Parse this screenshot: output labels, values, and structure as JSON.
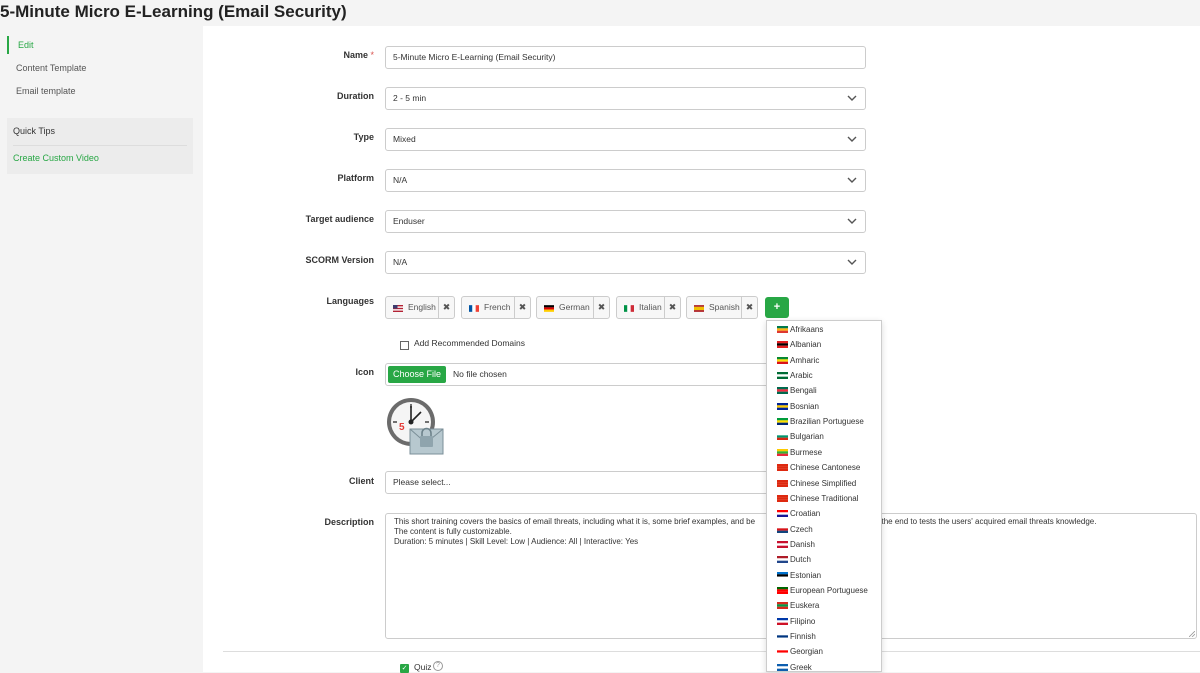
{
  "page": {
    "title": "5-Minute Micro E-Learning (Email Security)"
  },
  "sidebar": {
    "items": [
      {
        "label": "Edit",
        "active": true
      },
      {
        "label": "Content Template",
        "active": false
      },
      {
        "label": "Email template",
        "active": false
      }
    ],
    "tips": {
      "title": "Quick Tips",
      "link": "Create Custom Video"
    }
  },
  "form": {
    "name": {
      "label": "Name",
      "required_mark": "*",
      "value": "5-Minute Micro E-Learning (Email Security)"
    },
    "duration": {
      "label": "Duration",
      "value": "2 - 5 min"
    },
    "type": {
      "label": "Type",
      "value": "Mixed"
    },
    "platform": {
      "label": "Platform",
      "value": "N/A"
    },
    "target_audience": {
      "label": "Target audience",
      "value": "Enduser"
    },
    "scorm": {
      "label": "SCORM Version",
      "value": "N/A"
    },
    "languages": {
      "label": "Languages",
      "selected": [
        {
          "label": "English",
          "flag": [
            "#b22234",
            "#ffffff",
            "#3c3b6e"
          ]
        },
        {
          "label": "French",
          "flag": [
            "#0055a4",
            "#ffffff",
            "#ef4135"
          ]
        },
        {
          "label": "German",
          "flag": [
            "#000000",
            "#dd0000",
            "#ffce00"
          ]
        },
        {
          "label": "Italian",
          "flag": [
            "#009246",
            "#ffffff",
            "#ce2b37"
          ]
        },
        {
          "label": "Spanish",
          "flag": [
            "#aa151b",
            "#f1bf00",
            "#aa151b"
          ]
        }
      ],
      "remove_glyph": "✖",
      "add_label": "+"
    },
    "recommended_domains": {
      "label": "Add Recommended Domains",
      "checked": false
    },
    "icon": {
      "label": "Icon",
      "button": "Choose File",
      "status": "No file chosen"
    },
    "client": {
      "label": "Client",
      "placeholder": "Please select..."
    },
    "description": {
      "label": "Description",
      "lines": [
        "This short training covers the basics of email threats, including what it is, some brief examples, and be",
        "llenge at the end to tests the users' acquired email threats knowledge.",
        "The content is fully customizable.",
        "Duration: 5 minutes | Skill Level: Low | Audience: All | Interactive: Yes"
      ]
    },
    "quiz": {
      "label": "Quiz",
      "checked": true,
      "help": "?"
    }
  },
  "language_dropdown": {
    "options": [
      {
        "label": "Afrikaans",
        "flag": [
          "#007a4d",
          "#ffb612",
          "#de3831"
        ]
      },
      {
        "label": "Albanian",
        "flag": [
          "#e41e20",
          "#000000",
          "#e41e20"
        ]
      },
      {
        "label": "Amharic",
        "flag": [
          "#078930",
          "#fcdd09",
          "#da121a"
        ]
      },
      {
        "label": "Arabic",
        "flag": [
          "#006c35",
          "#ffffff",
          "#006c35"
        ]
      },
      {
        "label": "Bengali",
        "flag": [
          "#006a4e",
          "#f42a41",
          "#006a4e"
        ]
      },
      {
        "label": "Bosnian",
        "flag": [
          "#002395",
          "#fecb00",
          "#002395"
        ]
      },
      {
        "label": "Brazilian Portuguese",
        "flag": [
          "#009c3b",
          "#ffdf00",
          "#002776"
        ]
      },
      {
        "label": "Bulgarian",
        "flag": [
          "#ffffff",
          "#00966e",
          "#d62612"
        ]
      },
      {
        "label": "Burmese",
        "flag": [
          "#fecb00",
          "#34b233",
          "#ea2839"
        ]
      },
      {
        "label": "Chinese Cantonese",
        "flag": [
          "#de2910",
          "#de2910",
          "#de2910"
        ]
      },
      {
        "label": "Chinese Simplified",
        "flag": [
          "#de2910",
          "#de2910",
          "#de2910"
        ]
      },
      {
        "label": "Chinese Traditional",
        "flag": [
          "#de2910",
          "#de2910",
          "#de2910"
        ]
      },
      {
        "label": "Croatian",
        "flag": [
          "#ff0000",
          "#ffffff",
          "#171796"
        ]
      },
      {
        "label": "Czech",
        "flag": [
          "#ffffff",
          "#d7141a",
          "#11457e"
        ]
      },
      {
        "label": "Danish",
        "flag": [
          "#c8102e",
          "#ffffff",
          "#c8102e"
        ]
      },
      {
        "label": "Dutch",
        "flag": [
          "#ae1c28",
          "#ffffff",
          "#21468b"
        ]
      },
      {
        "label": "Estonian",
        "flag": [
          "#0072ce",
          "#000000",
          "#ffffff"
        ]
      },
      {
        "label": "European Portuguese",
        "flag": [
          "#006600",
          "#ff0000",
          "#ff0000"
        ]
      },
      {
        "label": "Euskera",
        "flag": [
          "#d52b1e",
          "#009b48",
          "#d52b1e"
        ]
      },
      {
        "label": "Filipino",
        "flag": [
          "#0038a8",
          "#ffffff",
          "#ce1126"
        ]
      },
      {
        "label": "Finnish",
        "flag": [
          "#ffffff",
          "#003580",
          "#ffffff"
        ]
      },
      {
        "label": "Georgian",
        "flag": [
          "#ffffff",
          "#ff0000",
          "#ffffff"
        ]
      },
      {
        "label": "Greek",
        "flag": [
          "#0d5eaf",
          "#ffffff",
          "#0d5eaf"
        ]
      }
    ]
  },
  "colors": {
    "accent": "#28a745",
    "border": "#cccccc"
  }
}
